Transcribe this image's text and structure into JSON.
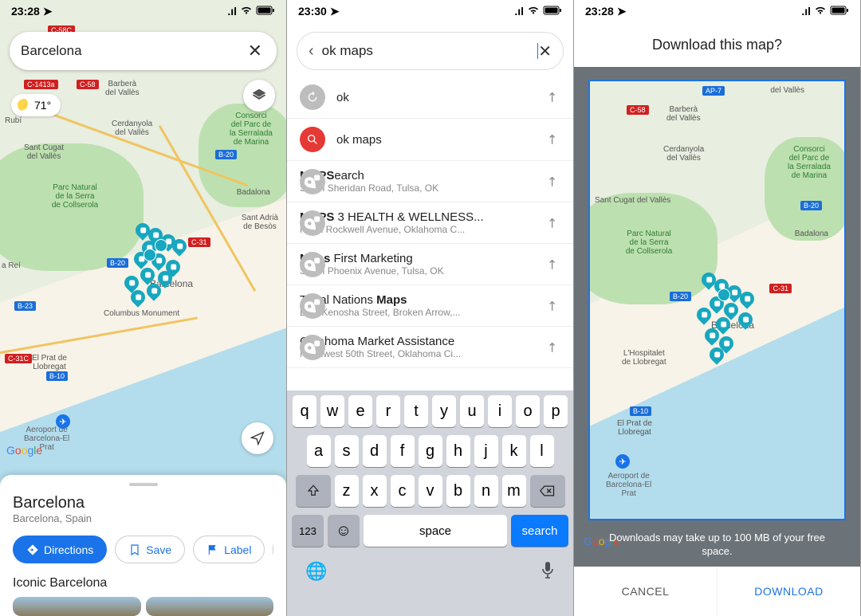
{
  "status": {
    "time_left": "23:28",
    "time_mid": "23:30",
    "time_right": "23:28"
  },
  "screen1": {
    "search_value": "Barcelona",
    "weather": "71°",
    "roads": {
      "c58c": "C-58C",
      "c1413a": "C-1413a",
      "c58": "C-58",
      "b20a": "B-20",
      "c31": "C-31",
      "b20b": "B-20",
      "b23": "B-23",
      "c31c": "C-31C",
      "b10": "B-10"
    },
    "places": {
      "barbera": "Barberà\ndel Vallès",
      "cerdanyola": "Cerdanyola\ndel Vallès",
      "santcugat": "Sant Cugat\ndel Vallès",
      "consorci": "Consorci\ndel Parc de\nla Serralada\nde Marina",
      "parcnat": "Parc Natural\nde la Serra\nde Collserola",
      "badalona": "Badalona",
      "santadria": "Sant Adrià\nde Besòs",
      "barcelona": "Barcelona",
      "rubi": "Rubí",
      "rei": "a Reí",
      "elprat": "El Prat de\nLlobregat",
      "aeroport": "Aeroport de\nBarcelona-El\nPrat",
      "columbus": "Columbus Monument"
    },
    "bottom_sheet": {
      "title": "Barcelona",
      "subtitle": "Barcelona, Spain",
      "btn_directions": "Directions",
      "btn_save": "Save",
      "btn_label": "Label",
      "section": "Iconic Barcelona"
    }
  },
  "screen2": {
    "search_value": "ok maps",
    "suggestions": [
      {
        "icon": "history",
        "title_plain": "ok"
      },
      {
        "icon": "search",
        "title_plain": "ok maps"
      },
      {
        "icon": "pin",
        "title_pre": "MAPS",
        "title_rest": "earch",
        "sub": "South Sheridan Road, Tulsa, OK"
      },
      {
        "icon": "pin",
        "title_pre": "MAPS",
        "title_rest": " 3 HEALTH & WELLNESS...",
        "sub": "North Rockwell Avenue, Oklahoma C..."
      },
      {
        "icon": "pin",
        "title_pre": "Maps",
        "title_rest": " First Marketing",
        "sub": "South Phoenix Avenue, Tulsa, OK"
      },
      {
        "icon": "pin",
        "title_pre": "",
        "title_mid": "Tribal Nations ",
        "title_bold": "Maps",
        "sub": "East Kenosha Street, Broken Arrow,..."
      },
      {
        "icon": "pin",
        "title_pre": "",
        "title_mid": "Oklahoma Market Assistance",
        "sub": "Northwest 50th Street, Oklahoma Ci..."
      }
    ],
    "keys_row1": [
      "q",
      "w",
      "e",
      "r",
      "t",
      "y",
      "u",
      "i",
      "o",
      "p"
    ],
    "keys_row2": [
      "a",
      "s",
      "d",
      "f",
      "g",
      "h",
      "j",
      "k",
      "l"
    ],
    "keys_row3": [
      "z",
      "x",
      "c",
      "v",
      "b",
      "n",
      "m"
    ],
    "key_123": "123",
    "key_space": "space",
    "key_search": "search"
  },
  "screen3": {
    "title": "Download this map?",
    "roads": {
      "ap7": "AP-7",
      "c58": "C-58",
      "b20a": "B-20",
      "b20b": "B-20",
      "c31": "C-31",
      "b10": "B-10"
    },
    "places": {
      "vallès": "del Vallès",
      "barbera": "Barberà\ndel Vallès",
      "cerdanyola": "Cerdanyola\ndel Vallès",
      "consorci": "Consorci\ndel Parc de\nla Serralada\nde Marina",
      "parcnat": "Parc Natural\nde la Serra\nde Collserola",
      "badalona": "Badalona",
      "santcugat": "Sant Cugat\ndel Vallès",
      "barcelona": "Barcelona",
      "hospitalet": "L'Hospitalet\nde Llobregat",
      "elprat": "El Prat de\nLlobregat",
      "aeroport": "Aeroport de\nBarcelona-El\nPrat"
    },
    "note": "Downloads may take up to 100 MB of your free space.",
    "btn_cancel": "CANCEL",
    "btn_download": "DOWNLOAD"
  }
}
